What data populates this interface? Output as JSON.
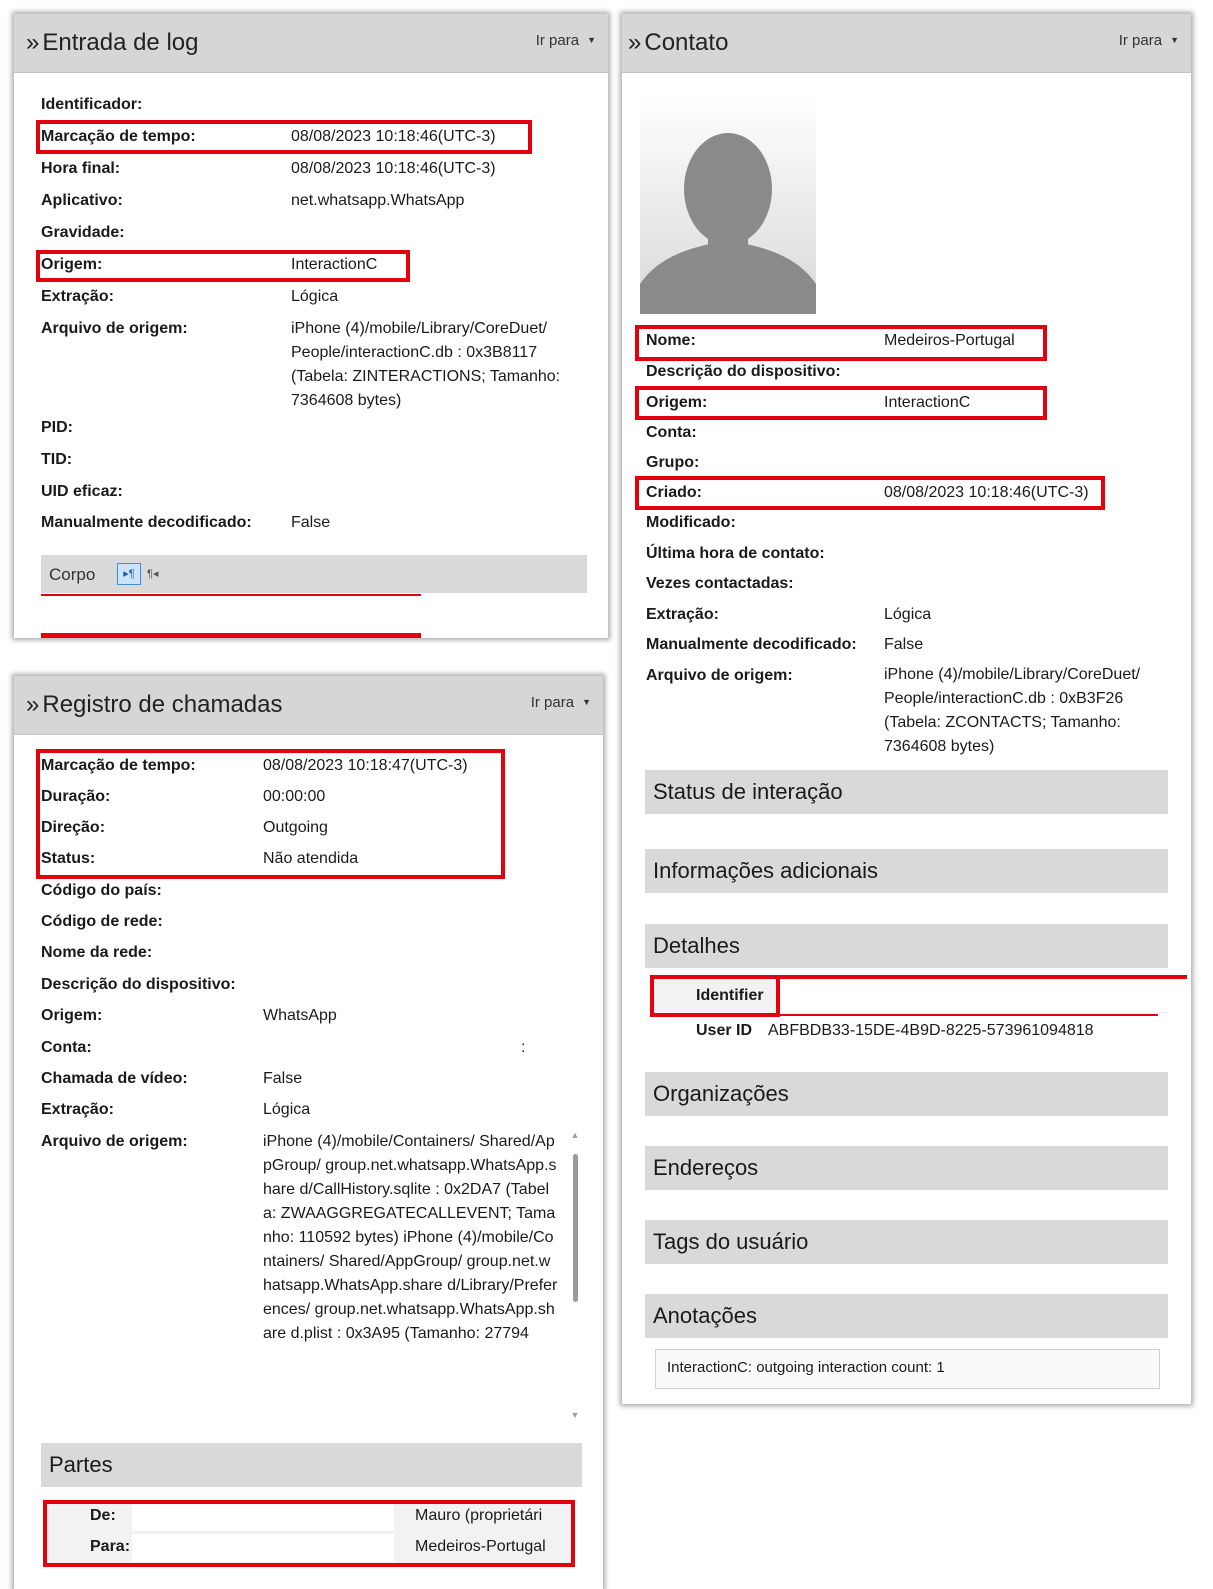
{
  "log_panel": {
    "title": "Entrada de log",
    "goto": "Ir para",
    "fields": [
      {
        "label": "Identificador:",
        "value": ""
      },
      {
        "label": "Marcação de tempo:",
        "value": "08/08/2023 10:18:46(UTC-3)"
      },
      {
        "label": "Hora final:",
        "value": "08/08/2023 10:18:46(UTC-3)"
      },
      {
        "label": "Aplicativo:",
        "value": "net.whatsapp.WhatsApp"
      },
      {
        "label": "Gravidade:",
        "value": ""
      },
      {
        "label": "Origem:",
        "value": "InteractionC"
      },
      {
        "label": "Extração:",
        "value": "Lógica"
      },
      {
        "label": "Arquivo de origem:",
        "value": "iPhone (4)/mobile/Library/CoreDuet/ People/interactionC.db : 0x3B8117 (Tabela: ZINTERACTIONS; Tamanho: 7364608 bytes)"
      },
      {
        "label": "PID:",
        "value": ""
      },
      {
        "label": "TID:",
        "value": ""
      },
      {
        "label": "UID eficaz:",
        "value": ""
      },
      {
        "label": "Manualmente decodificado:",
        "value": "False"
      }
    ],
    "body_label": "Corpo",
    "ltr_icon": "ltr-paragraph-icon",
    "rtl_icon": "rtl-paragraph-icon"
  },
  "calls_panel": {
    "title": "Registro de chamadas",
    "goto": "Ir para",
    "fields": [
      {
        "label": "Marcação de tempo:",
        "value": "08/08/2023 10:18:47(UTC-3)"
      },
      {
        "label": "Duração:",
        "value": "00:00:00"
      },
      {
        "label": "Direção:",
        "value": "Outgoing"
      },
      {
        "label": "Status:",
        "value": "Não atendida"
      },
      {
        "label": "Código do país:",
        "value": ""
      },
      {
        "label": "Código de rede:",
        "value": ""
      },
      {
        "label": "Nome da rede:",
        "value": ""
      },
      {
        "label": "Descrição do dispositivo:",
        "value": ""
      },
      {
        "label": "Origem:",
        "value": "WhatsApp"
      },
      {
        "label": "Conta:",
        "value": ":"
      },
      {
        "label": "Chamada de vídeo:",
        "value": "False"
      },
      {
        "label": "Extração:",
        "value": "Lógica"
      },
      {
        "label": "Arquivo de origem:",
        "value": "iPhone (4)/mobile/Containers/ Shared/AppGroup/ group.net.whatsapp.WhatsApp.share d/CallHistory.sqlite : 0x2DA7 (Tabela: ZWAAGGREGATECALLEVENT; Tamanho: 110592 bytes) iPhone (4)/mobile/Containers/ Shared/AppGroup/ group.net.whatsapp.WhatsApp.share d/Library/Preferences/ group.net.whatsapp.WhatsApp.share d.plist : 0x3A95 (Tamanho: 27794"
      }
    ],
    "parties_title": "Partes",
    "parties": [
      {
        "label": "De:",
        "value": "Mauro (proprietári"
      },
      {
        "label": "Para:",
        "value": "Medeiros-Portugal"
      }
    ]
  },
  "contact_panel": {
    "title": "Contato",
    "goto": "Ir para",
    "avatar_icon": "person-silhouette-icon",
    "fields": [
      {
        "label": "Nome:",
        "value": "Medeiros-Portugal"
      },
      {
        "label": "Descrição do dispositivo:",
        "value": ""
      },
      {
        "label": "Origem:",
        "value": "InteractionC"
      },
      {
        "label": "Conta:",
        "value": ""
      },
      {
        "label": "Grupo:",
        "value": ""
      },
      {
        "label": "Criado:",
        "value": "08/08/2023 10:18:46(UTC-3)"
      },
      {
        "label": "Modificado:",
        "value": ""
      },
      {
        "label": "Última hora de contato:",
        "value": ""
      },
      {
        "label": "Vezes contactadas:",
        "value": ""
      },
      {
        "label": "Extração:",
        "value": "Lógica"
      },
      {
        "label": "Manualmente decodificado:",
        "value": "False"
      },
      {
        "label": "Arquivo de origem:",
        "value": "iPhone (4)/mobile/Library/CoreDuet/ People/interactionC.db : 0xB3F26 (Tabela: ZCONTACTS; Tamanho: 7364608 bytes)"
      }
    ],
    "sections": {
      "status": "Status de interação",
      "info": "Informações adicionais",
      "details": "Detalhes",
      "orgs": "Organizações",
      "addresses": "Endereços",
      "tags": "Tags do usuário",
      "notes": "Anotações"
    },
    "details": {
      "identifier_label": "Identifier",
      "userid_label": "User ID",
      "userid_value": "ABFBDB33-15DE-4B9D-8225-573961094818"
    },
    "note_text": "InteractionC: outgoing interaction count: 1"
  },
  "colors": {
    "highlight": "#e3000f",
    "header": "#d6d6d6",
    "section": "#d9d9d9"
  }
}
